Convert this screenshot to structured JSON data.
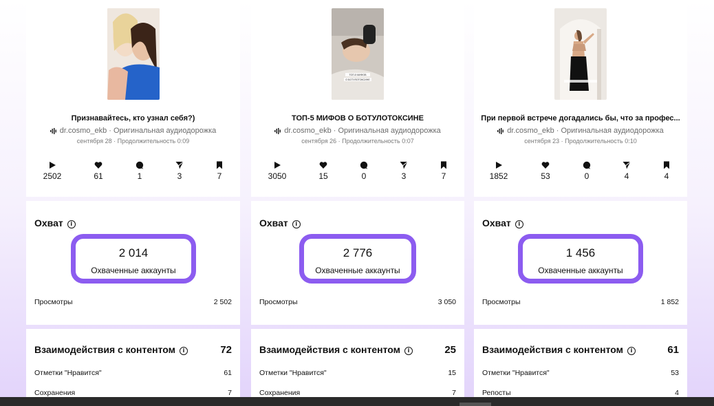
{
  "posts": [
    {
      "caption": "Признавайтесь, кто узнал себя?)",
      "author": "dr.cosmo_ekb",
      "audio": "Оригинальная аудиодорожка",
      "meta": "сентября 28 · Продолжительность 0:09",
      "stats": {
        "plays": "2502",
        "likes": "61",
        "comments": "1",
        "shares": "3",
        "saves": "7"
      },
      "reach_title": "Охват",
      "reach_value": "2 014",
      "reach_label": "Охваченные аккаунты",
      "views_label": "Просмотры",
      "views_value": "2 502",
      "interactions_title": "Взаимодействия с контентом",
      "interactions_total": "72",
      "rows": [
        {
          "label": "Отметки \"Нравится\"",
          "value": "61"
        },
        {
          "label": "Сохранения",
          "value": "7"
        }
      ]
    },
    {
      "caption": "ТОП-5 МИФОВ О БОТУЛОТОКСИНЕ",
      "author": "dr.cosmo_ekb",
      "audio": "Оригинальная аудиодорожка",
      "meta": "сентября 26 · Продолжительность 0:07",
      "thumb_text": "ТОП-5 МИФОВ О БОТУЛОТОКСИНЕ",
      "stats": {
        "plays": "3050",
        "likes": "15",
        "comments": "0",
        "shares": "3",
        "saves": "7"
      },
      "reach_title": "Охват",
      "reach_value": "2 776",
      "reach_label": "Охваченные аккаунты",
      "views_label": "Просмотры",
      "views_value": "3 050",
      "interactions_title": "Взаимодействия с контентом",
      "interactions_total": "25",
      "rows": [
        {
          "label": "Отметки \"Нравится\"",
          "value": "15"
        },
        {
          "label": "Сохранения",
          "value": "7"
        }
      ]
    },
    {
      "caption": "При первой встрече догадались бы, что за профес...",
      "author": "dr.cosmo_ekb",
      "audio": "Оригинальная аудиодорожка",
      "meta": "сентября 23 · Продолжительность 0:10",
      "stats": {
        "plays": "1852",
        "likes": "53",
        "comments": "0",
        "shares": "4",
        "saves": "4"
      },
      "reach_title": "Охват",
      "reach_value": "1 456",
      "reach_label": "Охваченные аккаунты",
      "views_label": "Просмотры",
      "views_value": "1 852",
      "interactions_title": "Взаимодействия с контентом",
      "interactions_total": "61",
      "rows": [
        {
          "label": "Отметки \"Нравится\"",
          "value": "53"
        },
        {
          "label": "Репосты",
          "value": "4"
        }
      ]
    }
  ],
  "icons": {
    "play": "play-icon",
    "like": "heart-icon",
    "comment": "comment-icon",
    "share": "share-icon",
    "save": "bookmark-icon",
    "info": "info-icon",
    "audio": "audio-wave-icon"
  },
  "colors": {
    "accent": "#8c5cf0",
    "gradient_bottom": "#e2d3fb"
  }
}
